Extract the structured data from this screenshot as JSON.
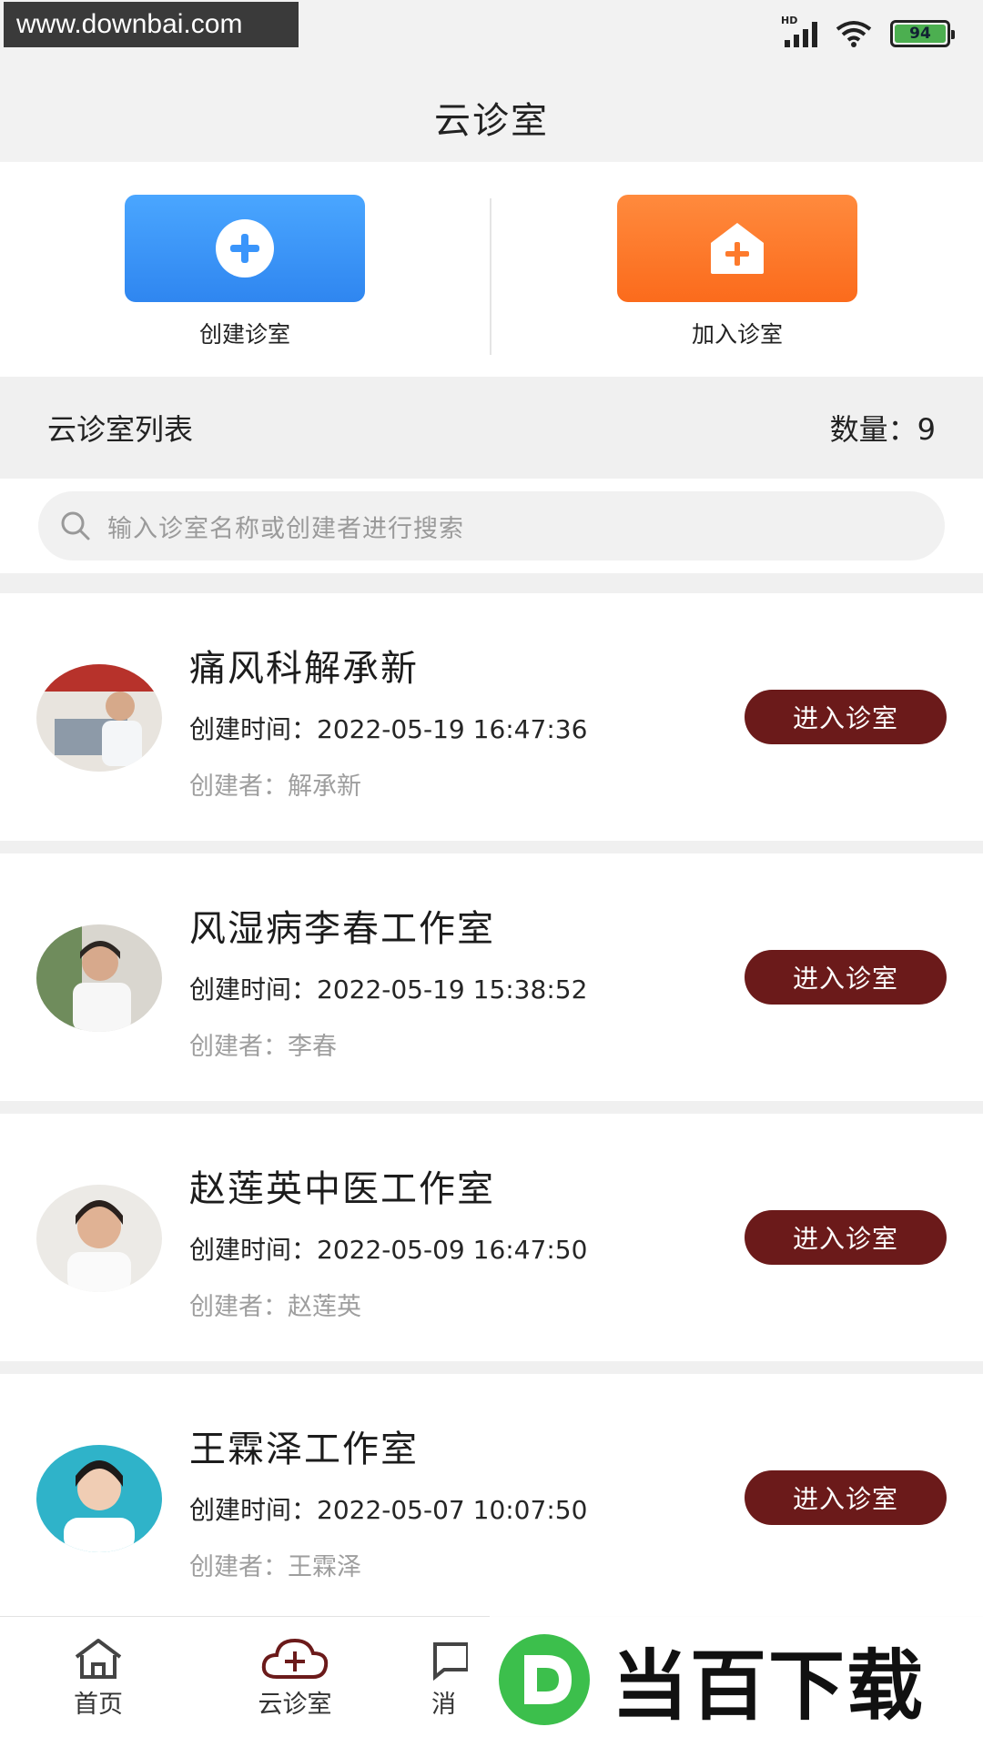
{
  "status_bar": {
    "watermark_text": "www.downbai.com",
    "battery_level": "94",
    "network_label": "HD"
  },
  "nav": {
    "title": "云诊室"
  },
  "actions": {
    "create_label": "创建诊室",
    "join_label": "加入诊室",
    "create_color": "#3a95fb",
    "join_color": "#fd7a2c"
  },
  "list_header": {
    "title": "云诊室列表",
    "count_label": "数量：9"
  },
  "search": {
    "placeholder": "输入诊室名称或创建者进行搜索"
  },
  "rooms": [
    {
      "name": "痛风科解承新",
      "created_time": "创建时间：2022-05-19 16:47:36",
      "creator": "创建者：解承新",
      "button": "进入诊室"
    },
    {
      "name": "风湿病李春工作室",
      "created_time": "创建时间：2022-05-19 15:38:52",
      "creator": "创建者：李春",
      "button": "进入诊室"
    },
    {
      "name": "赵莲英中医工作室",
      "created_time": "创建时间：2022-05-09 16:47:50",
      "creator": "创建者：赵莲英",
      "button": "进入诊室"
    },
    {
      "name": "王霖泽工作室",
      "created_time": "创建时间：2022-05-07 10:07:50",
      "creator": "创建者：王霖泽",
      "button": "进入诊室"
    }
  ],
  "tabbar": {
    "home": "首页",
    "cloud": "云诊室",
    "message": "消"
  },
  "brand": {
    "text": "当百下载",
    "accent_color": "#3cbf4c"
  },
  "colors": {
    "enter_button": "#6b1a1a"
  }
}
